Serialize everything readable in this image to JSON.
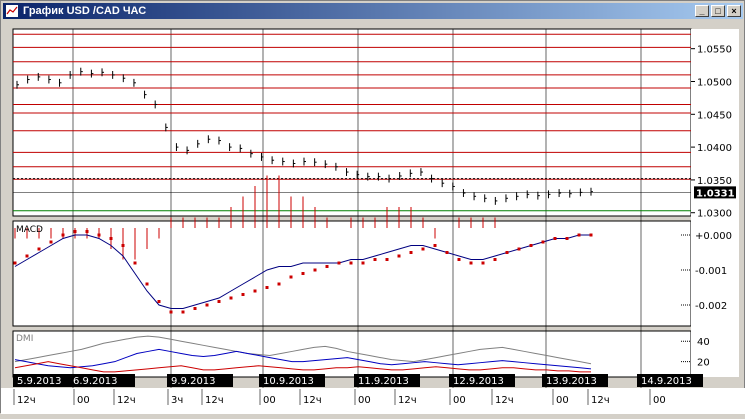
{
  "window": {
    "title": "График USD /CAD  ЧАС",
    "controls": {
      "minimize": "_",
      "maximize": "□",
      "close": "×"
    }
  },
  "colors": {
    "background": "#ffffff",
    "grid": "#000000",
    "resistance": "#c00000",
    "support": "#008000",
    "price_label_bg": "#000000",
    "macd_signal": "#cc0000",
    "macd_line": "#000080",
    "dmi_gray": "#808080",
    "dmi_blue": "#0000c0",
    "dmi_red": "#cc0000"
  },
  "price_panel": {
    "price_label": "1.0331",
    "axis_labels": [
      "1.0550",
      "1.0500",
      "1.0450",
      "1.0400",
      "1.0350",
      "1.0300"
    ]
  },
  "macd_panel": {
    "title": "MACD",
    "axis_labels": [
      "0.000",
      "-0.001",
      "-0.002"
    ]
  },
  "dmi_panel": {
    "title": "DMI",
    "axis_labels": [
      "40",
      "20"
    ]
  },
  "time_axis": {
    "date_labels": [
      "5.9.2013",
      "6.9.2013",
      "9.9.2013",
      "10.9.2013",
      "11.9.2013",
      "12.9.2013",
      "13.9.2013",
      "14.9.2013"
    ],
    "hour_labels": [
      "12ч",
      "00",
      "12ч",
      "3ч",
      "12ч",
      "00",
      "12ч",
      "00",
      "12ч",
      "00",
      "12ч",
      "00",
      "12ч",
      "00"
    ]
  },
  "chart_data": [
    {
      "type": "line",
      "title": "USD /CAD",
      "ylim": [
        1.0295,
        1.058
      ],
      "series": [
        {
          "values": [
            1.0495,
            1.0503,
            1.0507,
            1.0503,
            1.0498,
            1.051,
            1.0515,
            1.0512,
            1.0514,
            1.051,
            1.0505,
            1.0498,
            1.048,
            1.0465,
            1.043,
            1.04,
            1.0395,
            1.0405,
            1.0412,
            1.041,
            1.04,
            1.0398,
            1.039,
            1.0385,
            1.038,
            1.0378,
            1.0375,
            1.0378,
            1.0377,
            1.0374,
            1.037,
            1.0362,
            1.0358,
            1.0355,
            1.0355,
            1.0352,
            1.0356,
            1.036,
            1.0362,
            1.0352,
            1.0345,
            1.034,
            1.033,
            1.0325,
            1.0322,
            1.0318,
            1.0322,
            1.0325,
            1.0328,
            1.0326,
            1.0328,
            1.033,
            1.0329,
            1.0331,
            1.0332
          ]
        }
      ]
    },
    {
      "type": "line",
      "title": "MACD",
      "ylim": [
        -0.0026,
        0.0004
      ],
      "series": [
        {
          "values": [
            -0.0008,
            -0.0006,
            -0.0004,
            -0.0002,
            0.0,
            0.0001,
            0.0001,
            0.0,
            -0.0001,
            -0.0003,
            -0.0008,
            -0.0014,
            -0.0019,
            -0.0022,
            -0.0022,
            -0.0021,
            -0.002,
            -0.0019,
            -0.0018,
            -0.0017,
            -0.0016,
            -0.0015,
            -0.0014,
            -0.0012,
            -0.0011,
            -0.001,
            -0.0009,
            -0.0008,
            -0.0008,
            -0.0008,
            -0.0007,
            -0.0007,
            -0.0006,
            -0.0005,
            -0.0004,
            -0.0003,
            -0.0005,
            -0.0007,
            -0.0008,
            -0.0008,
            -0.0007,
            -0.0005,
            -0.0004,
            -0.0003,
            -0.0002,
            -0.0001,
            -0.0001,
            0.0,
            0.0
          ]
        },
        {
          "values": [
            -0.0009,
            -0.0007,
            -0.0005,
            -0.0003,
            -0.0001,
            0.0,
            0.0,
            -0.0001,
            -0.0003,
            -0.0006,
            -0.0011,
            -0.0016,
            -0.002,
            -0.0021,
            -0.0021,
            -0.002,
            -0.0019,
            -0.0018,
            -0.0016,
            -0.0014,
            -0.0012,
            -0.001,
            -0.0009,
            -0.0009,
            -0.0008,
            -0.0008,
            -0.0008,
            -0.0008,
            -0.0007,
            -0.0007,
            -0.0006,
            -0.0005,
            -0.0004,
            -0.0003,
            -0.0003,
            -0.0004,
            -0.0005,
            -0.0006,
            -0.0007,
            -0.0007,
            -0.0006,
            -0.0005,
            -0.0004,
            -0.0003,
            -0.0002,
            -0.0001,
            -0.0001,
            0.0,
            0.0
          ]
        }
      ]
    },
    {
      "type": "line",
      "title": "DMI",
      "ylim": [
        5,
        50
      ],
      "series": [
        {
          "values": [
            20,
            22,
            24,
            26,
            28,
            30,
            32,
            35,
            38,
            40,
            42,
            44,
            45,
            44,
            42,
            40,
            38,
            36,
            34,
            32,
            30,
            28,
            27,
            26,
            28,
            30,
            32,
            34,
            35,
            33,
            30,
            28,
            26,
            24,
            22,
            21,
            20,
            22,
            24,
            26,
            28,
            30,
            32,
            33,
            34,
            32,
            30,
            28,
            26,
            24,
            22,
            20,
            18
          ]
        },
        {
          "values": [
            22,
            20,
            18,
            16,
            15,
            14,
            15,
            16,
            18,
            20,
            24,
            28,
            30,
            32,
            30,
            28,
            26,
            25,
            26,
            28,
            30,
            28,
            26,
            24,
            22,
            20,
            20,
            21,
            22,
            23,
            24,
            22,
            20,
            18,
            17,
            18,
            19,
            20,
            19,
            18,
            17,
            18,
            19,
            20,
            21,
            20,
            19,
            18,
            17,
            16,
            15,
            14,
            13
          ]
        },
        {
          "values": [
            14,
            16,
            18,
            20,
            18,
            16,
            14,
            12,
            10,
            10,
            11,
            12,
            13,
            14,
            15,
            16,
            14,
            12,
            12,
            13,
            14,
            15,
            16,
            15,
            14,
            13,
            12,
            12,
            13,
            14,
            14,
            15,
            14,
            13,
            12,
            12,
            13,
            14,
            15,
            14,
            13,
            12,
            12,
            13,
            14,
            14,
            13,
            12,
            12,
            11,
            11,
            10,
            10
          ]
        }
      ]
    }
  ]
}
